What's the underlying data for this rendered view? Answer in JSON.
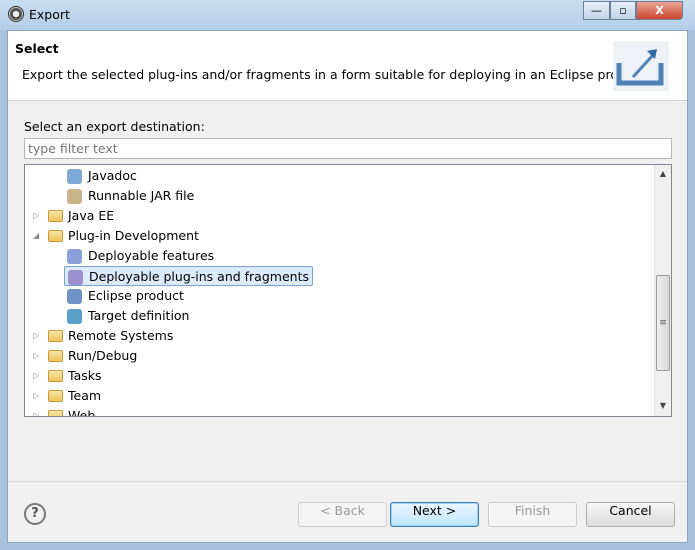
{
  "window": {
    "title": "Export",
    "minimize": "—",
    "maximize": "▫",
    "close": "X"
  },
  "header": {
    "title": "Select",
    "description": "Export the selected plug-ins and/or fragments in a form suitable for deploying in an Eclipse product.",
    "icon": "export-wizard-icon"
  },
  "destination": {
    "label": "Select an export destination:",
    "filter_placeholder": "type filter text"
  },
  "tree": [
    {
      "label": "Javadoc",
      "level": 2,
      "icon": "javadoc-icon"
    },
    {
      "label": "Runnable JAR file",
      "level": 2,
      "icon": "jar-icon"
    },
    {
      "label": "Java EE",
      "level": 1,
      "icon": "folder-icon",
      "expanded": false
    },
    {
      "label": "Plug-in Development",
      "level": 1,
      "icon": "folder-icon",
      "expanded": true
    },
    {
      "label": "Deployable features",
      "level": 2,
      "icon": "feature-icon"
    },
    {
      "label": "Deployable plug-ins and fragments",
      "level": 2,
      "icon": "plugin-icon",
      "selected": true
    },
    {
      "label": "Eclipse product",
      "level": 2,
      "icon": "product-icon"
    },
    {
      "label": "Target definition",
      "level": 2,
      "icon": "target-icon"
    },
    {
      "label": "Remote Systems",
      "level": 1,
      "icon": "folder-icon",
      "expanded": false
    },
    {
      "label": "Run/Debug",
      "level": 1,
      "icon": "folder-icon",
      "expanded": false
    },
    {
      "label": "Tasks",
      "level": 1,
      "icon": "folder-icon",
      "expanded": false
    },
    {
      "label": "Team",
      "level": 1,
      "icon": "folder-icon",
      "expanded": false
    },
    {
      "label": "Web",
      "level": 1,
      "icon": "folder-icon",
      "expanded": false
    }
  ],
  "buttons": {
    "help": "?",
    "back": "< Back",
    "next": "Next >",
    "finish": "Finish",
    "cancel": "Cancel"
  }
}
